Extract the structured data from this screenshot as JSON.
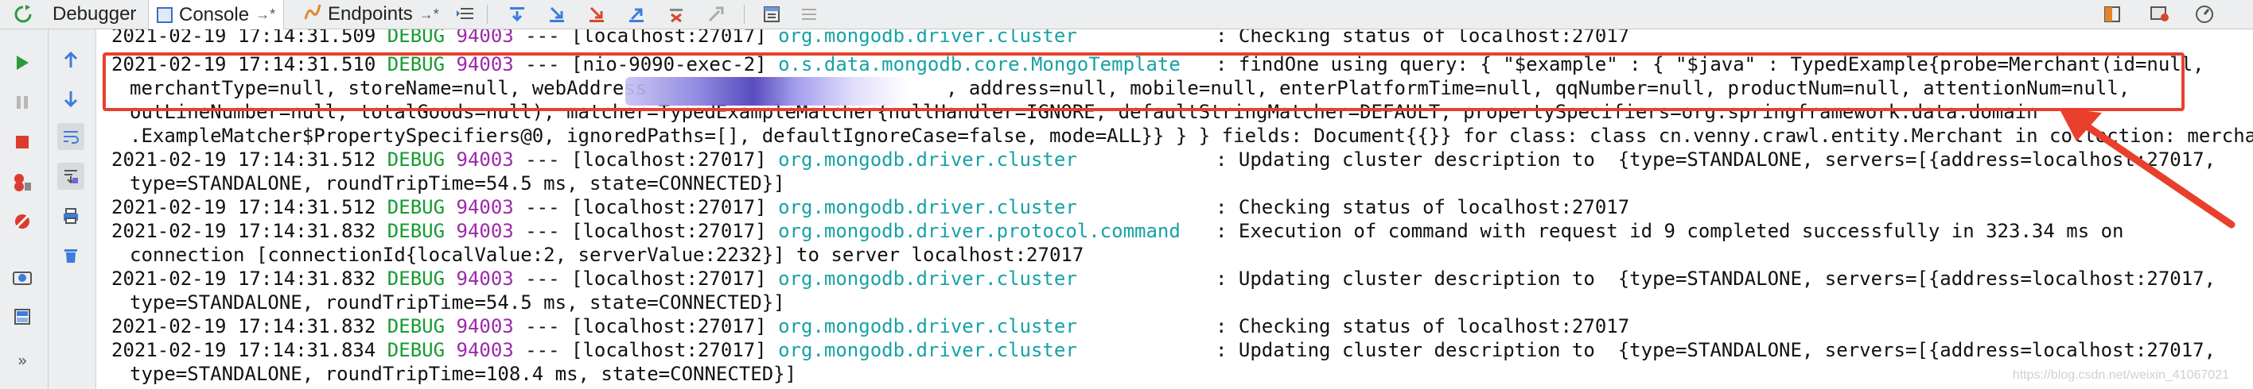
{
  "tabs": [
    {
      "label": "Debugger",
      "active": false
    },
    {
      "label": "Console",
      "active": true,
      "pin": "→*"
    },
    {
      "label": "Endpoints",
      "active": false,
      "pin": "→*"
    }
  ],
  "colors": {
    "debug": "#159b30",
    "pid": "#9b2aa8",
    "logger": "#17a2a6",
    "highlight": "#e8402d",
    "toolbar_bg": "#eceeef"
  },
  "log": {
    "l0": {
      "ts": "2021-02-19 17:14:31.509",
      "level": "DEBUG",
      "pid": "94003",
      "thread": " --- [localhost:27017] ",
      "logger": "org.mongodb.driver.cluster",
      "msg": ": Checking status of localhost:27017"
    },
    "l1": {
      "ts": "2021-02-19 17:14:31.510",
      "level": "DEBUG",
      "pid": "94003",
      "thread": " --- [nio-9090-exec-2] ",
      "logger": "o.s.data.mongodb.core.MongoTemplate",
      "msg": ": findOne using query: { \"$example\" : { \"$java\" : TypedExample{probe=Merchant(id=null,"
    },
    "l2a": "merchantType=null, storeName=null, webAddress",
    "l2b": ", address=null, mobile=null, enterPlatformTime=null, qqNumber=null, productNum=null, attentionNum=null,",
    "l3": "outLineNumber=null, totalGoods=null), matcher=TypedExampleMatcher{nullHandler=IGNORE, defaultStringMatcher=DEFAULT, propertySpecifiers=org.springframework.data.domain",
    "l4": ".ExampleMatcher$PropertySpecifiers@0, ignoredPaths=[], defaultIgnoreCase=false, mode=ALL}} } } fields: Document{{}} for class: class cn.venny.crawl.entity.Merchant in collection: merchants",
    "l5": {
      "ts": "2021-02-19 17:14:31.512",
      "level": "DEBUG",
      "pid": "94003",
      "thread": " --- [localhost:27017] ",
      "logger": "org.mongodb.driver.cluster",
      "msg": ": Updating cluster description to  {type=STANDALONE, servers=[{address=localhost:27017,"
    },
    "l6": "type=STANDALONE, roundTripTime=54.5 ms, state=CONNECTED}]",
    "l7": {
      "ts": "2021-02-19 17:14:31.512",
      "level": "DEBUG",
      "pid": "94003",
      "thread": " --- [localhost:27017] ",
      "logger": "org.mongodb.driver.cluster",
      "msg": ": Checking status of localhost:27017"
    },
    "l8": {
      "ts": "2021-02-19 17:14:31.832",
      "level": "DEBUG",
      "pid": "94003",
      "thread": " --- [localhost:27017] ",
      "logger": "org.mongodb.driver.protocol.command",
      "msg": ": Execution of command with request id 9 completed successfully in 323.34 ms on"
    },
    "l9": "connection [connectionId{localValue:2, serverValue:2232}] to server localhost:27017",
    "l10": {
      "ts": "2021-02-19 17:14:31.832",
      "level": "DEBUG",
      "pid": "94003",
      "thread": " --- [localhost:27017] ",
      "logger": "org.mongodb.driver.cluster",
      "msg": ": Updating cluster description to  {type=STANDALONE, servers=[{address=localhost:27017,"
    },
    "l11": "type=STANDALONE, roundTripTime=54.5 ms, state=CONNECTED}]",
    "l12": {
      "ts": "2021-02-19 17:14:31.832",
      "level": "DEBUG",
      "pid": "94003",
      "thread": " --- [localhost:27017] ",
      "logger": "org.mongodb.driver.cluster",
      "msg": ": Checking status of localhost:27017"
    },
    "l13": {
      "ts": "2021-02-19 17:14:31.834",
      "level": "DEBUG",
      "pid": "94003",
      "thread": " --- [localhost:27017] ",
      "logger": "org.mongodb.driver.cluster",
      "msg": ": Updating cluster description to  {type=STANDALONE, servers=[{address=localhost:27017,"
    },
    "l14": "type=STANDALONE, roundTripTime=108.4 ms, state=CONNECTED}]"
  },
  "watermark": "https://blog.csdn.net/weixin_41067021"
}
